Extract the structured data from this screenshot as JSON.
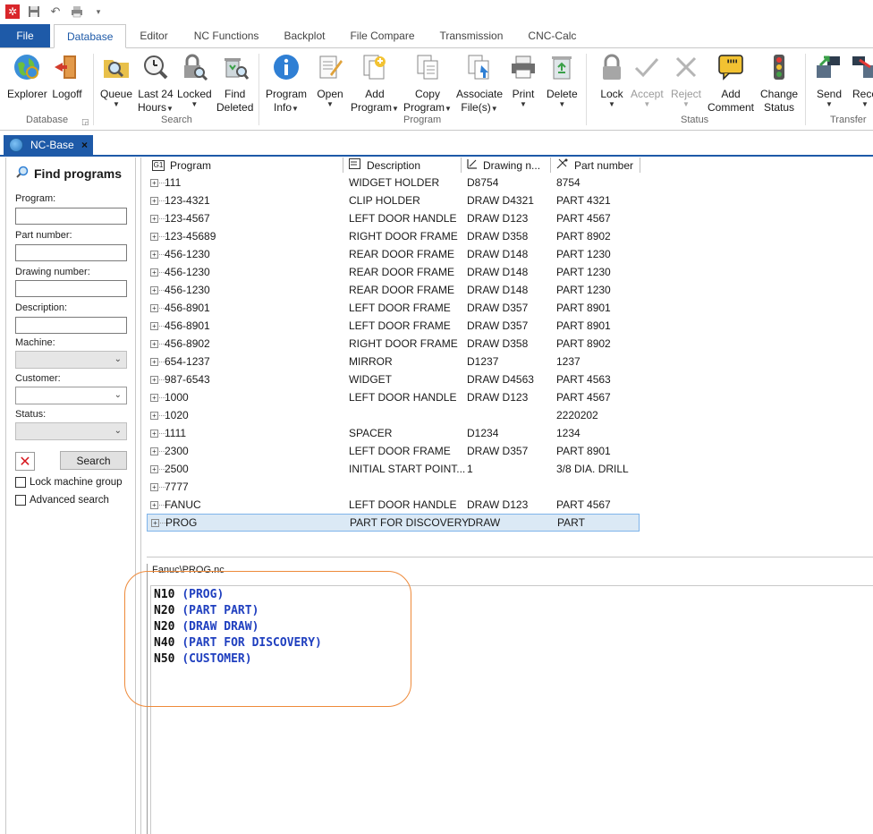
{
  "qat": {
    "icons": [
      "app-logo-icon",
      "save-icon",
      "undo-icon",
      "print-icon",
      "customize-icon"
    ]
  },
  "tabs": [
    {
      "label": "File"
    },
    {
      "label": "Database"
    },
    {
      "label": "Editor"
    },
    {
      "label": "NC Functions"
    },
    {
      "label": "Backplot"
    },
    {
      "label": "File Compare"
    },
    {
      "label": "Transmission"
    },
    {
      "label": "CNC-Calc"
    }
  ],
  "ribbon": {
    "buttons": {
      "explorer": {
        "l1": "Explorer",
        "l2": ""
      },
      "logoff": {
        "l1": "Logoff",
        "l2": ""
      },
      "queue": {
        "l1": "Queue",
        "l2": ""
      },
      "last24": {
        "l1": "Last 24",
        "l2": "Hours"
      },
      "locked": {
        "l1": "Locked",
        "l2": ""
      },
      "finddeleted": {
        "l1": "Find",
        "l2": "Deleted"
      },
      "programinfo": {
        "l1": "Program",
        "l2": "Info"
      },
      "open": {
        "l1": "Open",
        "l2": ""
      },
      "addprogram": {
        "l1": "Add",
        "l2": "Program"
      },
      "copyprogram": {
        "l1": "Copy",
        "l2": "Program"
      },
      "associate": {
        "l1": "Associate",
        "l2": "File(s)"
      },
      "print": {
        "l1": "Print",
        "l2": ""
      },
      "delete": {
        "l1": "Delete",
        "l2": ""
      },
      "lock": {
        "l1": "Lock",
        "l2": ""
      },
      "accept": {
        "l1": "Accept",
        "l2": ""
      },
      "reject": {
        "l1": "Reject",
        "l2": ""
      },
      "addcomment": {
        "l1": "Add",
        "l2": "Comment"
      },
      "changestatus": {
        "l1": "Change",
        "l2": "Status"
      },
      "send": {
        "l1": "Send",
        "l2": ""
      },
      "receive": {
        "l1": "Rece",
        "l2": ""
      }
    },
    "groups": {
      "database": "Database",
      "search": "Search",
      "program": "Program",
      "status": "Status",
      "transfer": "Transfer"
    }
  },
  "doc_tab": {
    "label": "NC-Base",
    "close": "×"
  },
  "find": {
    "title": "Find programs",
    "program_label": "Program:",
    "part_label": "Part number:",
    "drawing_label": "Drawing number:",
    "description_label": "Description:",
    "machine_label": "Machine:",
    "customer_label": "Customer:",
    "status_label": "Status:",
    "search_button": "Search",
    "lock_machine_group": "Lock machine group",
    "advanced_search": "Advanced search"
  },
  "grid": {
    "columns": [
      "Program",
      "Description",
      "Drawing n...",
      "Part number"
    ],
    "rows": [
      {
        "program": "111",
        "description": "WIDGET HOLDER",
        "drawing": "D8754",
        "part": "8754"
      },
      {
        "program": "123-4321",
        "description": "CLIP HOLDER",
        "drawing": "DRAW D4321",
        "part": "PART 4321"
      },
      {
        "program": "123-4567",
        "description": "LEFT DOOR HANDLE",
        "drawing": "DRAW D123",
        "part": "PART 4567"
      },
      {
        "program": "123-45689",
        "description": "RIGHT DOOR FRAME",
        "drawing": "DRAW D358",
        "part": "PART 8902"
      },
      {
        "program": "456-1230",
        "description": "REAR DOOR FRAME",
        "drawing": "DRAW D148",
        "part": "PART 1230"
      },
      {
        "program": "456-1230",
        "description": "REAR DOOR FRAME",
        "drawing": "DRAW D148",
        "part": "PART 1230"
      },
      {
        "program": "456-1230",
        "description": "REAR DOOR FRAME",
        "drawing": "DRAW D148",
        "part": "PART 1230"
      },
      {
        "program": "456-8901",
        "description": "LEFT DOOR FRAME",
        "drawing": "DRAW D357",
        "part": "PART 8901"
      },
      {
        "program": "456-8901",
        "description": "LEFT DOOR FRAME",
        "drawing": "DRAW D357",
        "part": "PART 8901"
      },
      {
        "program": "456-8902",
        "description": "RIGHT DOOR FRAME",
        "drawing": "DRAW D358",
        "part": "PART 8902"
      },
      {
        "program": "654-1237",
        "description": "MIRROR",
        "drawing": "D1237",
        "part": "1237"
      },
      {
        "program": "987-6543",
        "description": "WIDGET",
        "drawing": "DRAW D4563",
        "part": "PART 4563"
      },
      {
        "program": "1000",
        "description": "LEFT DOOR HANDLE",
        "drawing": "DRAW D123",
        "part": "PART 4567"
      },
      {
        "program": "1020",
        "description": "",
        "drawing": "",
        "part": "2220202"
      },
      {
        "program": "1111",
        "description": "SPACER",
        "drawing": "D1234",
        "part": "1234"
      },
      {
        "program": "2300",
        "description": "LEFT DOOR FRAME",
        "drawing": "DRAW D357",
        "part": "PART 8901"
      },
      {
        "program": "2500",
        "description": "INITIAL START POINT...",
        "drawing": "1",
        "part": "3/8 DIA. DRILL"
      },
      {
        "program": "7777",
        "description": "",
        "drawing": "",
        "part": ""
      },
      {
        "program": "FANUC",
        "description": "LEFT DOOR HANDLE",
        "drawing": "DRAW D123",
        "part": "PART 4567"
      },
      {
        "program": "PROG",
        "description": "PART FOR DISCOVERY",
        "drawing": "DRAW",
        "part": "PART",
        "selected": true
      }
    ]
  },
  "preview": {
    "path": "Fanuc\\PROG.nc",
    "lines": [
      {
        "n": "N10",
        "c": "(PROG)"
      },
      {
        "n": "N20",
        "c": "(PART PART)"
      },
      {
        "n": "N20",
        "c": "(DRAW DRAW)"
      },
      {
        "n": "N40",
        "c": "(PART FOR DISCOVERY)"
      },
      {
        "n": "N50",
        "c": "(CUSTOMER)"
      }
    ]
  },
  "colors": {
    "accent": "#1e5aa8",
    "highlight": "#ee8a3a",
    "code_comment": "#1f3fbf",
    "selection": "#dbe9f5"
  }
}
